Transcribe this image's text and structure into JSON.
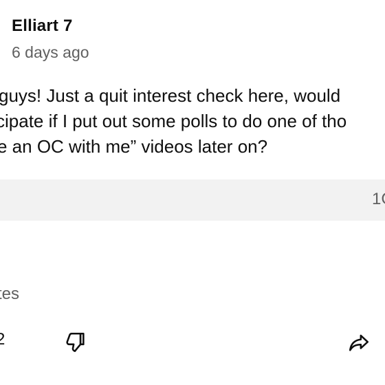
{
  "post": {
    "author": "Elliart 7",
    "timestamp": "6 days ago",
    "body_lines": [
      "guys! Just a quit interest check here, would",
      "cipate if I put out some polls to do one of tho",
      "e an OC with me” videos later on?"
    ]
  },
  "poll": {
    "option_count": "1C"
  },
  "footer": {
    "votes_label": "tes",
    "like_count": "2",
    "dislike_icon": "thumbs-down-icon",
    "share_icon": "share-icon"
  }
}
